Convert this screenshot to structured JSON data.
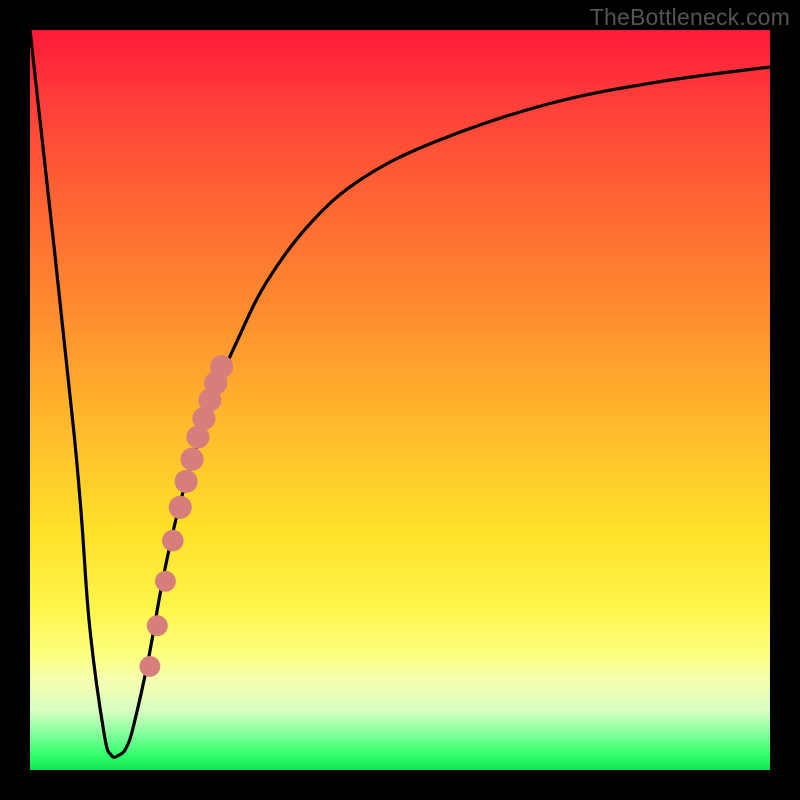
{
  "watermark": "TheBottleneck.com",
  "colors": {
    "frame": "#000000",
    "curve": "#000000",
    "dots": "#d67e7b",
    "gradient_top": "#ff1a3a",
    "gradient_bottom": "#14e554"
  },
  "chart_data": {
    "type": "line",
    "title": "",
    "xlabel": "",
    "ylabel": "",
    "xlim": [
      0,
      100
    ],
    "ylim": [
      0,
      100
    ],
    "grid": false,
    "legend": null,
    "series": [
      {
        "name": "bottleneck-curve",
        "x": [
          0,
          6,
          8,
          10,
          11,
          12,
          13,
          14,
          16,
          18,
          20,
          22,
          25,
          28,
          32,
          38,
          45,
          55,
          70,
          85,
          100
        ],
        "y": [
          100,
          45,
          20,
          5,
          2,
          2,
          3,
          6,
          15,
          26,
          35,
          42,
          51,
          58,
          66,
          74,
          80,
          85,
          90,
          93,
          95
        ]
      }
    ],
    "highlight_segment": {
      "name": "salmon-dots",
      "points": [
        {
          "x": 16.2,
          "y": 14.0,
          "r": 1.2
        },
        {
          "x": 17.2,
          "y": 19.5,
          "r": 1.2
        },
        {
          "x": 18.3,
          "y": 25.5,
          "r": 1.2
        },
        {
          "x": 19.3,
          "y": 31.0,
          "r": 1.3
        },
        {
          "x": 20.3,
          "y": 35.5,
          "r": 1.5
        },
        {
          "x": 21.1,
          "y": 39.0,
          "r": 1.5
        },
        {
          "x": 21.9,
          "y": 42.0,
          "r": 1.5
        },
        {
          "x": 22.7,
          "y": 45.0,
          "r": 1.5
        },
        {
          "x": 23.5,
          "y": 47.5,
          "r": 1.5
        },
        {
          "x": 24.3,
          "y": 50.0,
          "r": 1.5
        },
        {
          "x": 25.1,
          "y": 52.3,
          "r": 1.5
        },
        {
          "x": 25.9,
          "y": 54.5,
          "r": 1.5
        }
      ]
    },
    "gradient_bands": [
      {
        "label": "red",
        "y_from": 70,
        "y_to": 100
      },
      {
        "label": "orange",
        "y_from": 40,
        "y_to": 70
      },
      {
        "label": "yellow",
        "y_from": 12,
        "y_to": 40
      },
      {
        "label": "green",
        "y_from": 0,
        "y_to": 12
      }
    ]
  }
}
